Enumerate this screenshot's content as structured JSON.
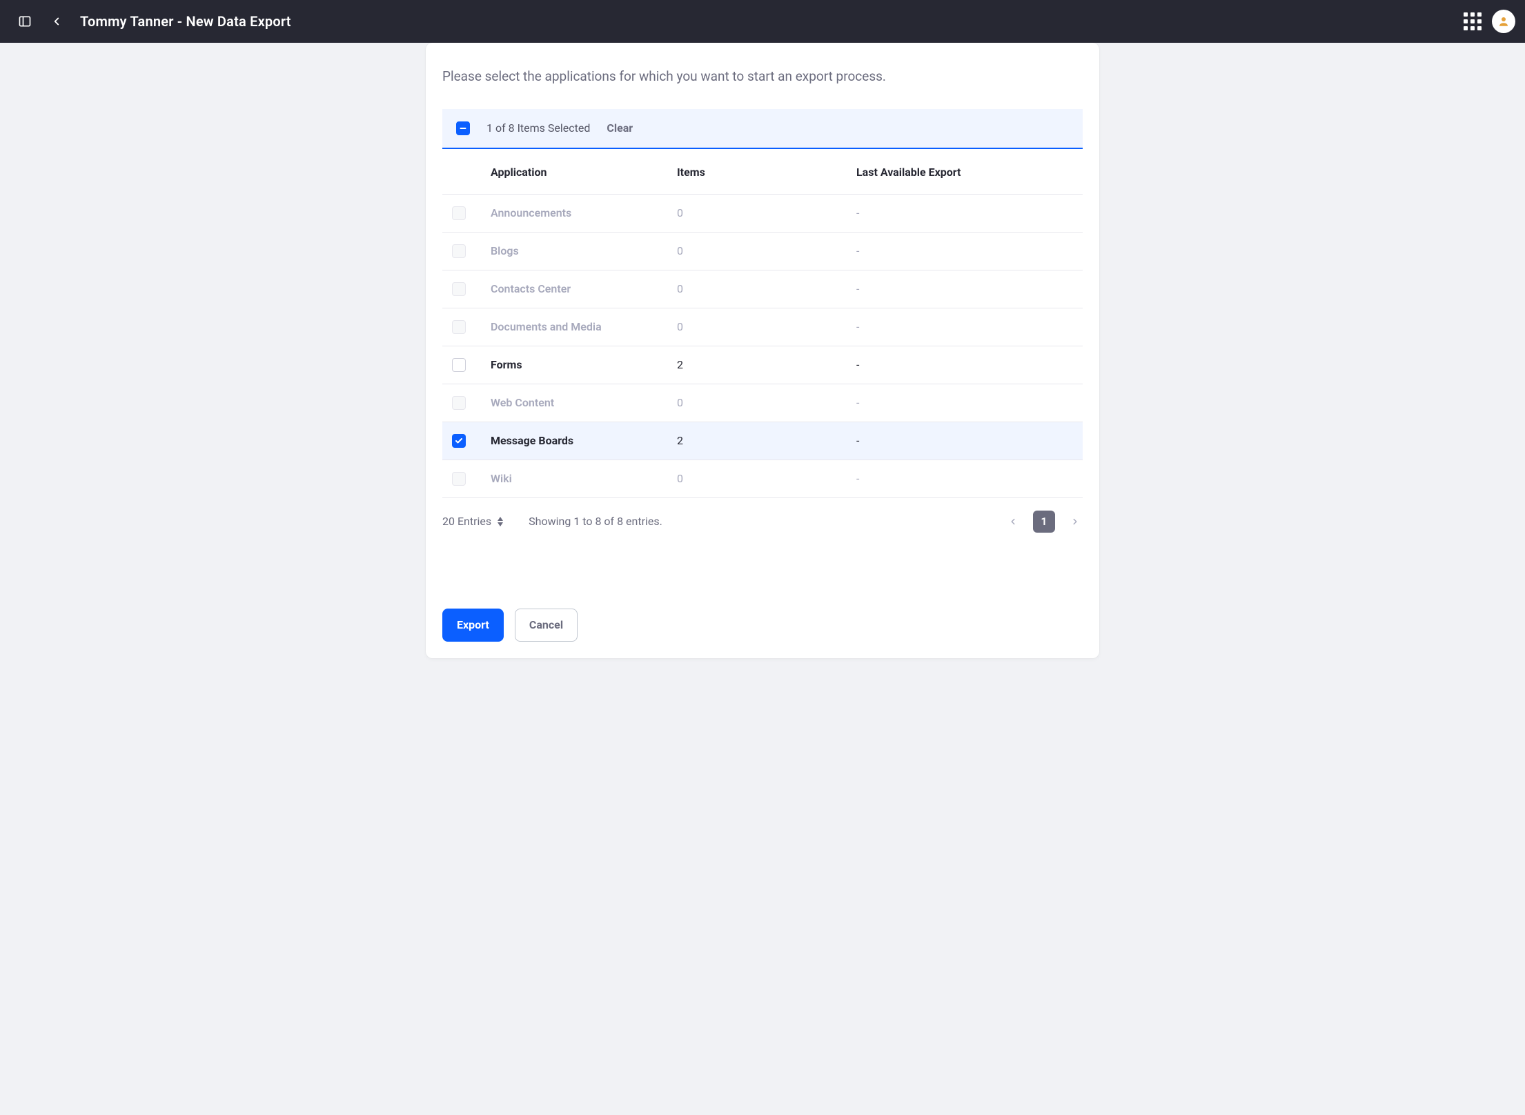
{
  "header": {
    "title": "Tommy Tanner - New Data Export"
  },
  "helper": "Please select the applications for which you want to start an export process.",
  "selection": {
    "count_text": "1 of 8 Items Selected",
    "clear_label": "Clear"
  },
  "table": {
    "columns": {
      "application": "Application",
      "items": "Items",
      "last_export": "Last Available Export"
    },
    "rows": [
      {
        "app": "Announcements",
        "items": "0",
        "last_export": "-",
        "disabled": true,
        "checked": false
      },
      {
        "app": "Blogs",
        "items": "0",
        "last_export": "-",
        "disabled": true,
        "checked": false
      },
      {
        "app": "Contacts Center",
        "items": "0",
        "last_export": "-",
        "disabled": true,
        "checked": false
      },
      {
        "app": "Documents and Media",
        "items": "0",
        "last_export": "-",
        "disabled": true,
        "checked": false
      },
      {
        "app": "Forms",
        "items": "2",
        "last_export": "-",
        "disabled": false,
        "checked": false
      },
      {
        "app": "Web Content",
        "items": "0",
        "last_export": "-",
        "disabled": true,
        "checked": false
      },
      {
        "app": "Message Boards",
        "items": "2",
        "last_export": "-",
        "disabled": false,
        "checked": true
      },
      {
        "app": "Wiki",
        "items": "0",
        "last_export": "-",
        "disabled": true,
        "checked": false
      }
    ]
  },
  "pagination": {
    "page_size_label": "20 Entries",
    "status": "Showing 1 to 8 of 8 entries.",
    "current": "1"
  },
  "actions": {
    "export_label": "Export",
    "cancel_label": "Cancel"
  }
}
